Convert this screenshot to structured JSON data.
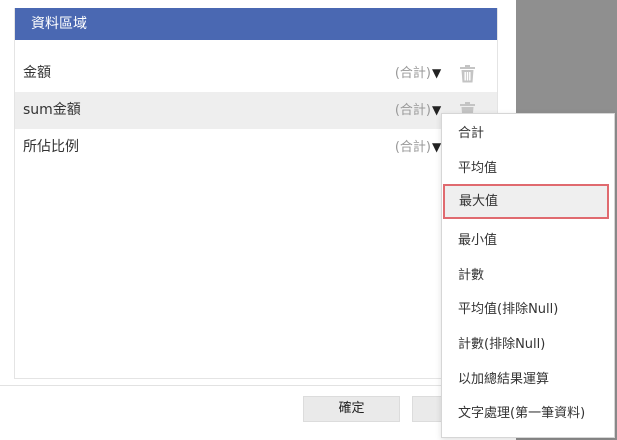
{
  "panel": {
    "title": "資料區域",
    "fields": [
      {
        "name": "金額",
        "aggregation": "(合計)"
      },
      {
        "name": "sum金額",
        "aggregation": "(合計)"
      },
      {
        "name": "所佔比例",
        "aggregation": "(合計)"
      }
    ]
  },
  "footer": {
    "ok_label": "確定"
  },
  "dropdown": {
    "selected": "最大值",
    "items": [
      "合計",
      "平均值",
      "最大值",
      "最小值",
      "計數",
      "平均值(排除Null)",
      "計數(排除Null)",
      "以加總結果運算",
      "文字處理(第一筆資料)"
    ]
  },
  "icons": {
    "caret": "caret-down-icon",
    "delete": "trash-icon"
  },
  "colors": {
    "header_bg": "#4a68b2",
    "selected_outline": "#e06a6f",
    "overlay_gray": "#8f8f8f"
  }
}
